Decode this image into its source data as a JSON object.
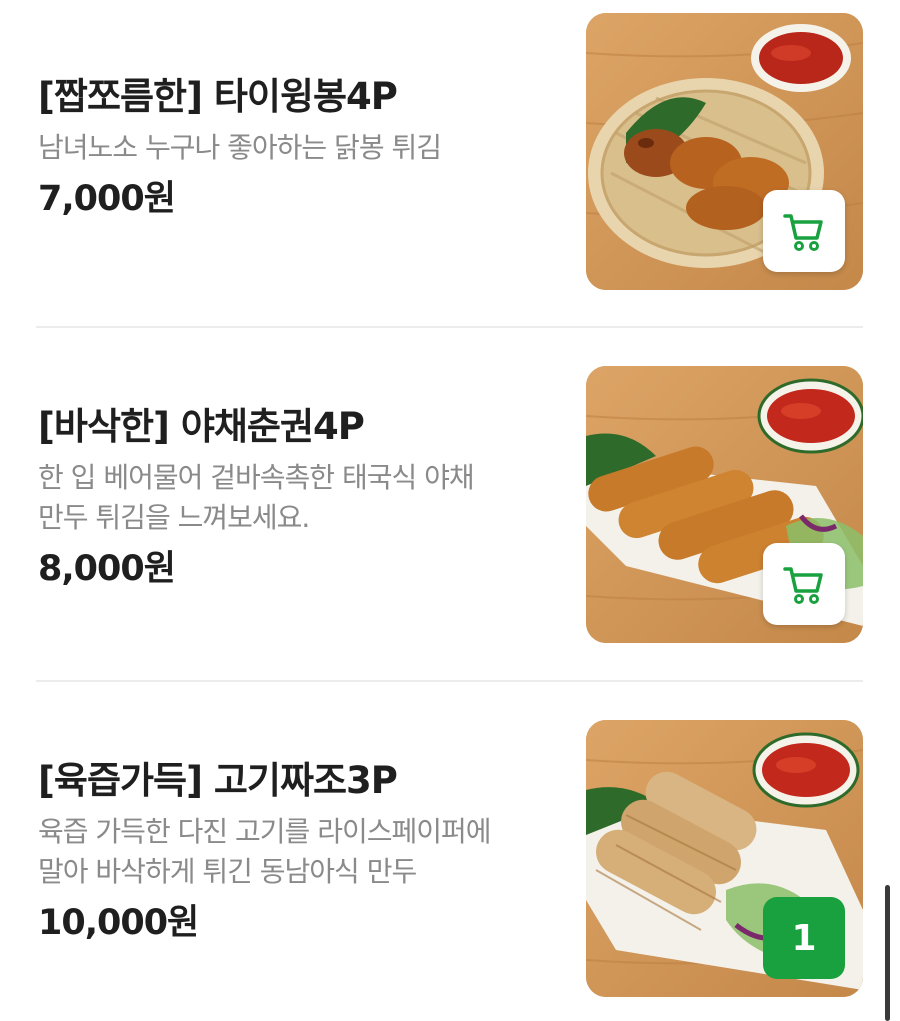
{
  "menu": {
    "items": [
      {
        "name": "[짭쪼름한] 타이윙봉4P",
        "description_lines": [
          "남녀노소 누구나 좋아하는 닭봉 튀김"
        ],
        "price": "7,000원",
        "photo": "fried-chicken-wings-photo",
        "action": "cart"
      },
      {
        "name": "[바삭한] 야채춘권4P",
        "description_lines": [
          "한 입 베어물어 겉바속촉한 태국식 야채",
          "만두 튀김을 느껴보세요."
        ],
        "price": "8,000원",
        "photo": "vegetable-spring-rolls-photo",
        "action": "cart"
      },
      {
        "name": "[육즙가득] 고기짜조3P",
        "description_lines": [
          "육즙 가득한 다진 고기를 라이스페이퍼에",
          "말아 바삭하게 튀긴 동남아식 만두"
        ],
        "price": "10,000원",
        "photo": "meat-cha-gio-photo",
        "action": "quantity",
        "quantity": "1"
      }
    ]
  },
  "colors": {
    "accent_green": "#19a13f",
    "title_text": "#1f1f1f",
    "description_text": "#8a8a8a",
    "divider": "#ececec",
    "wood_background": "#d19a5a"
  },
  "icons": {
    "cart": "shopping-cart-icon"
  }
}
